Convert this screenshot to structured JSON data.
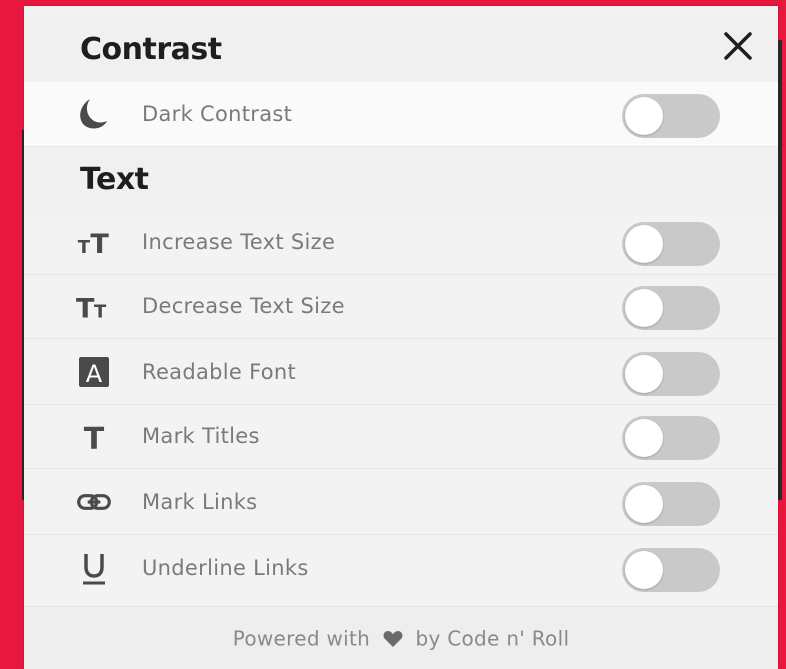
{
  "sections": {
    "contrast": {
      "title": "Contrast",
      "items": [
        {
          "label": "Dark Contrast",
          "icon": "moon-icon",
          "enabled": false
        }
      ]
    },
    "text": {
      "title": "Text",
      "items": [
        {
          "label": "Increase Text Size",
          "icon": "increase-text-icon",
          "enabled": false
        },
        {
          "label": "Decrease Text Size",
          "icon": "decrease-text-icon",
          "enabled": false
        },
        {
          "label": "Readable Font",
          "icon": "readable-font-icon",
          "enabled": false
        },
        {
          "label": "Mark Titles",
          "icon": "title-icon",
          "enabled": false
        },
        {
          "label": "Mark Links",
          "icon": "link-icon",
          "enabled": false
        },
        {
          "label": "Underline Links",
          "icon": "underline-icon",
          "enabled": false
        }
      ]
    }
  },
  "close_icon": "close-icon",
  "footer": {
    "prefix": "Powered with",
    "suffix": "by Code n' Roll",
    "icon": "heart-icon"
  },
  "colors": {
    "background": "#e8173d",
    "panel": "#f3f3f3",
    "toggle_off": "#c9c9c9",
    "knob": "#ffffff"
  }
}
